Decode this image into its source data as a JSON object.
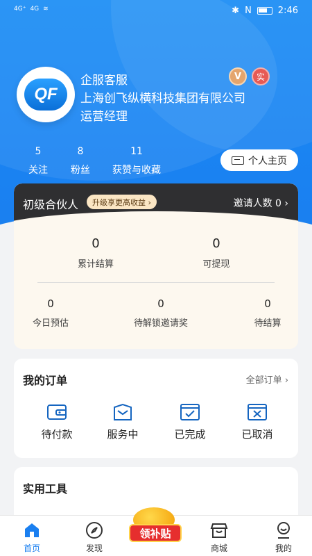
{
  "status_bar": {
    "time": "2:46",
    "signal_left": "4G⁺",
    "signal_right": "4G",
    "nfc": "N"
  },
  "profile": {
    "logo_text": "QF",
    "name": "企服客服",
    "company": "上海创飞纵横科技集团有限公司",
    "role": "运营经理",
    "badge_v": "V",
    "badge_shi": "实"
  },
  "stats": [
    {
      "value": "5",
      "label": "关注"
    },
    {
      "value": "8",
      "label": "粉丝"
    },
    {
      "value": "11",
      "label": "获赞与收藏"
    }
  ],
  "home_button": {
    "label": "个人主页"
  },
  "partner": {
    "title": "初级合伙人",
    "upgrade_tag": "升级享更高收益 ›",
    "invite": "邀请人数 0 ›",
    "primary": [
      {
        "value": "0",
        "label": "累计结算"
      },
      {
        "value": "0",
        "label": "可提现"
      }
    ],
    "secondary": [
      {
        "value": "0",
        "label": "今日预估"
      },
      {
        "value": "0",
        "label": "待解锁邀请奖"
      },
      {
        "value": "0",
        "label": "待结算"
      }
    ]
  },
  "orders": {
    "title": "我的订单",
    "all_label": "全部订单 ›",
    "items": [
      {
        "label": "待付款",
        "icon": "wallet-icon"
      },
      {
        "label": "服务中",
        "icon": "service-icon"
      },
      {
        "label": "已完成",
        "icon": "check-box-icon"
      },
      {
        "label": "已取消",
        "icon": "cancel-box-icon"
      }
    ]
  },
  "tools": {
    "title": "实用工具"
  },
  "tabbar": {
    "items": [
      {
        "label": "首页",
        "icon": "home-icon",
        "active": true
      },
      {
        "label": "发现",
        "icon": "compass-icon",
        "active": false
      },
      {
        "label": "商城",
        "icon": "store-icon",
        "active": false
      },
      {
        "label": "我的",
        "icon": "profile-icon",
        "active": false
      }
    ],
    "promo_label": "领补贴"
  },
  "colors": {
    "primary": "#1a7ff0",
    "partner_dark": "#2f2f31",
    "partner_bg": "#fdf8ef",
    "promo_red": "#e62e2e"
  }
}
